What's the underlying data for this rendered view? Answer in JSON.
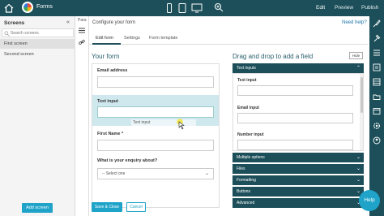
{
  "app": {
    "name": "Forms"
  },
  "top_menu": {
    "edit": "Edit",
    "preview": "Preview",
    "publish": "Publish"
  },
  "screens_panel": {
    "title": "Screens",
    "search_placeholder": "Search screens",
    "items": [
      {
        "label": "First screen",
        "selected": true
      },
      {
        "label": "Second screen",
        "selected": false
      }
    ],
    "add_button": "Add screen"
  },
  "mini_panel": {
    "tab_label": "Para"
  },
  "configure": {
    "title": "Configure your form",
    "help_link": "Need help?",
    "tabs": [
      {
        "label": "Edit form",
        "active": true
      },
      {
        "label": "Settings",
        "active": false
      },
      {
        "label": "Form template",
        "active": false
      }
    ]
  },
  "your_form": {
    "title": "Your form",
    "fields": {
      "email_label": "Email address",
      "text_input_label": "Text input",
      "drag_ghost_label": "Text input",
      "first_name_label": "First Name *",
      "enquiry_label": "What is your enquiry about?",
      "enquiry_select_value": "-- Select one"
    },
    "save_button": "Save & Close",
    "cancel_button": "Cancel"
  },
  "drag_drop": {
    "title": "Drag and drop to add a field",
    "hide_button": "Hide",
    "sections": [
      "Text inputs",
      "Multiple options",
      "Files",
      "Formatting",
      "Buttons",
      "Advanced"
    ],
    "text_input_items": [
      "Text input",
      "Email input",
      "Number input"
    ]
  },
  "help_button": "Help",
  "colors": {
    "header": "#1c4f5a",
    "accent": "#1fa3c9",
    "drop_highlight": "#cfe8ee"
  }
}
